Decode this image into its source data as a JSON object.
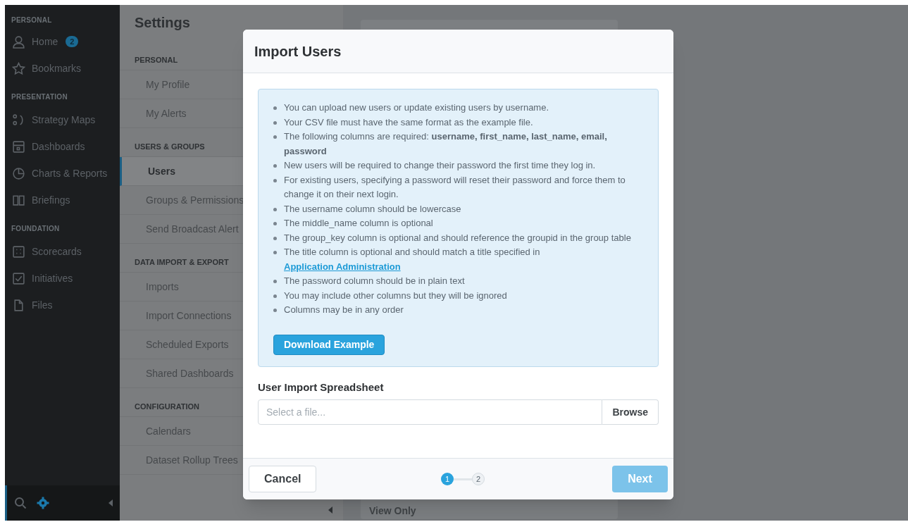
{
  "sidebar": {
    "sections": [
      {
        "heading": "PERSONAL",
        "items": [
          {
            "label": "Home",
            "badge": "2"
          },
          {
            "label": "Bookmarks"
          }
        ]
      },
      {
        "heading": "PRESENTATION",
        "items": [
          {
            "label": "Strategy Maps"
          },
          {
            "label": "Dashboards"
          },
          {
            "label": "Charts & Reports"
          },
          {
            "label": "Briefings"
          }
        ]
      },
      {
        "heading": "FOUNDATION",
        "items": [
          {
            "label": "Scorecards"
          },
          {
            "label": "Initiatives"
          },
          {
            "label": "Files"
          }
        ]
      }
    ],
    "footer": {
      "settings_selected": true
    }
  },
  "settings": {
    "title": "Settings",
    "sections": [
      {
        "heading": "PERSONAL",
        "items": [
          {
            "label": "My Profile",
            "selected": false
          },
          {
            "label": "My Alerts",
            "selected": false
          }
        ]
      },
      {
        "heading": "USERS & GROUPS",
        "items": [
          {
            "label": "Users",
            "selected": true
          },
          {
            "label": "Groups & Permissions",
            "selected": false
          },
          {
            "label": "Send Broadcast Alert",
            "selected": false
          }
        ]
      },
      {
        "heading": "DATA IMPORT & EXPORT",
        "items": [
          {
            "label": "Imports",
            "selected": false
          },
          {
            "label": "Import Connections",
            "selected": false
          },
          {
            "label": "Scheduled Exports",
            "selected": false
          },
          {
            "label": "Shared Dashboards",
            "selected": false
          }
        ]
      },
      {
        "heading": "CONFIGURATION",
        "items": [
          {
            "label": "Calendars",
            "selected": false
          },
          {
            "label": "Dataset Rollup Trees",
            "selected": false
          }
        ]
      }
    ]
  },
  "background": {
    "bottom_card_label": "View Only"
  },
  "modal": {
    "title": "Import Users",
    "instructions": [
      {
        "text": "You can upload new users or update existing users by username."
      },
      {
        "text": "Your CSV file must have the same format as the example file."
      },
      {
        "text": "The following columns are required: **username, first_name, last_name, email, password**"
      },
      {
        "text": "New users will be required to change their password the first time they log in."
      },
      {
        "text": "For existing users, specifying a password will reset their password and force them to change it on their next login."
      },
      {
        "text": "The username column should be lowercase"
      },
      {
        "text": "The middle_name column is optional"
      },
      {
        "text": "The group_key column is optional and should reference the groupid in the group table"
      },
      {
        "text": "The title column is optional and should match a title specified in",
        "link": "Application Administration"
      },
      {
        "text": "The password column should be in plain text"
      },
      {
        "text": "You may include other columns but they will be ignored"
      },
      {
        "text": "Columns may be in any order"
      }
    ],
    "download_button": "Download Example",
    "file_label": "User Import Spreadsheet",
    "file_field": {
      "placeholder": "Select a file..."
    },
    "browse_button": "Browse",
    "cancel_button": "Cancel",
    "steps": [
      {
        "label": "1",
        "selected": true
      },
      {
        "label": "2",
        "selected": false
      }
    ],
    "next_button": {
      "label": "Next",
      "disabled": true
    }
  }
}
